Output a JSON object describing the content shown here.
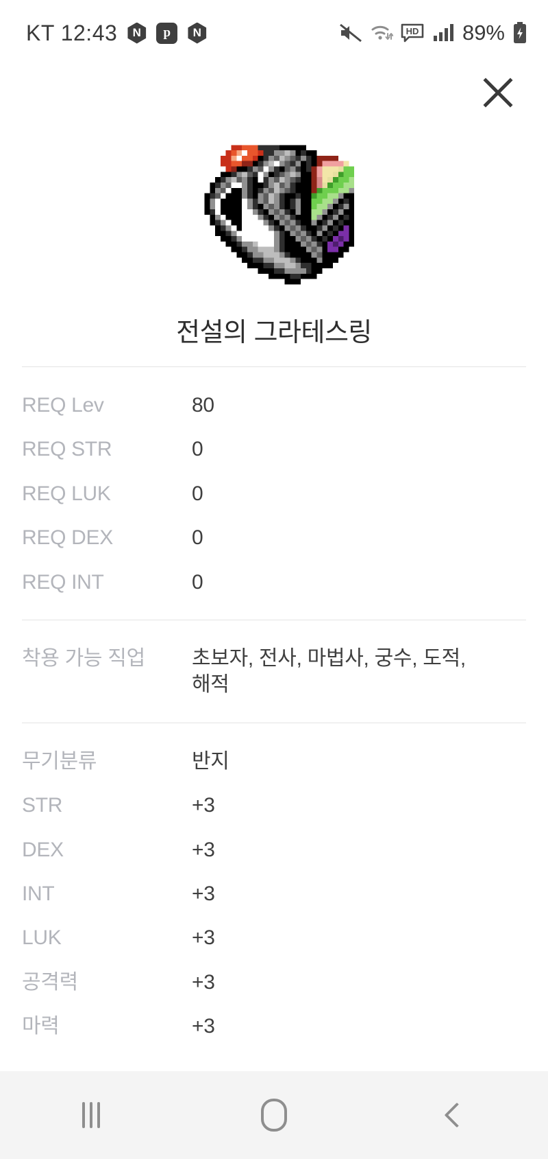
{
  "statusbar": {
    "carrier_time": "KT 12:43",
    "app_icons": [
      {
        "name": "naver-icon",
        "glyph": "N"
      },
      {
        "name": "naver-pay-icon",
        "glyph": "p"
      },
      {
        "name": "naver-icon",
        "glyph": "N"
      }
    ],
    "mute_icon": "mute-icon",
    "wifi_icon": "wifi-icon",
    "hd_label": "HD",
    "signal_icon": "signal-bars-icon",
    "battery_percent": "89%",
    "battery_icon": "battery-charging-icon"
  },
  "header": {
    "close_label": "×"
  },
  "item": {
    "image_name": "legendary-gratess-ring-sprite",
    "title": "전설의 그라테스링"
  },
  "sections": [
    {
      "name": "requirements",
      "rows": [
        {
          "label": "REQ Lev",
          "value": "80"
        },
        {
          "label": "REQ STR",
          "value": "0"
        },
        {
          "label": "REQ LUK",
          "value": "0"
        },
        {
          "label": "REQ DEX",
          "value": "0"
        },
        {
          "label": "REQ INT",
          "value": "0"
        }
      ]
    },
    {
      "name": "job-requirements",
      "rows": [
        {
          "label": "착용 가능 직업",
          "value": "초보자, 전사, 마법사, 궁수, 도적, 해적"
        }
      ]
    },
    {
      "name": "item-stats",
      "rows": [
        {
          "label": "무기분류",
          "value": "반지"
        },
        {
          "label": "STR",
          "value": "+3"
        },
        {
          "label": "DEX",
          "value": "+3"
        },
        {
          "label": "INT",
          "value": "+3"
        },
        {
          "label": "LUK",
          "value": "+3"
        },
        {
          "label": "공격력",
          "value": "+3"
        },
        {
          "label": "마력",
          "value": "+3"
        }
      ]
    }
  ],
  "navbar": {
    "recents_label": "recents-icon",
    "home_label": "home-icon",
    "back_label": "back-icon"
  },
  "colors": {
    "label_gray": "#b3b5bb",
    "value_dark": "#3f3f3f",
    "divider": "#e4e4e4",
    "navbar_bg": "#f4f4f4"
  }
}
